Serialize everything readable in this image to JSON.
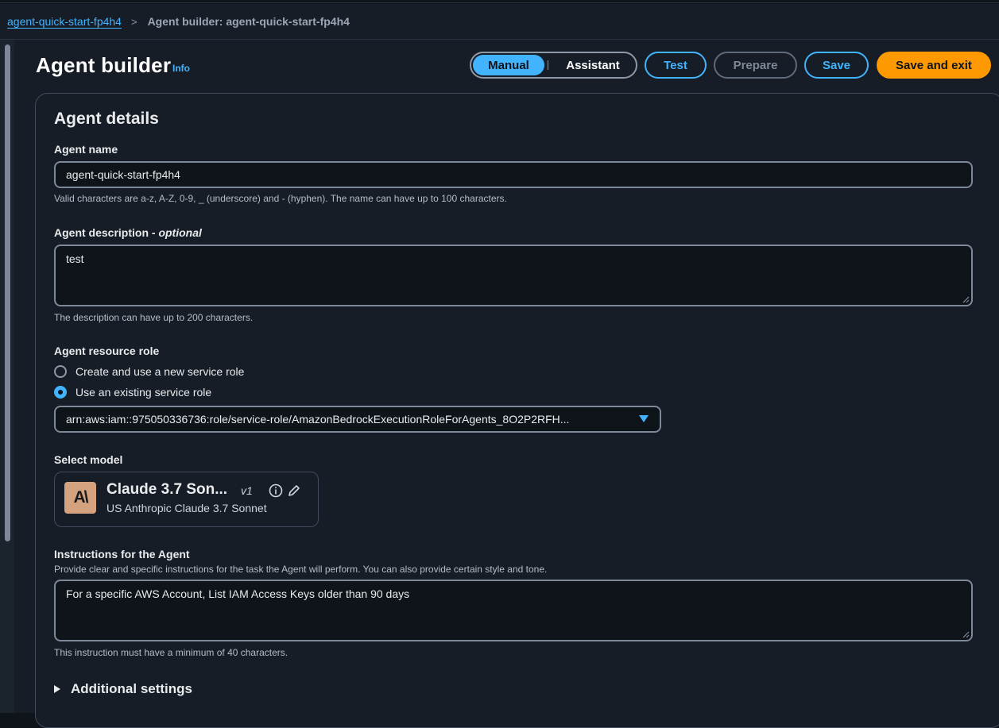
{
  "breadcrumb": {
    "parent": "agent-quick-start-fp4h4",
    "separator": ">",
    "current": "Agent builder: agent-quick-start-fp4h4"
  },
  "header": {
    "title": "Agent builder",
    "info": "Info",
    "mode_toggle": {
      "active": "Manual",
      "inactive": "Assistant"
    },
    "buttons": {
      "test": "Test",
      "prepare": "Prepare",
      "save": "Save",
      "save_exit": "Save and exit"
    }
  },
  "agent_details": {
    "heading": "Agent details",
    "name": {
      "label": "Agent name",
      "value": "agent-quick-start-fp4h4",
      "hint": "Valid characters are a-z, A-Z, 0-9, _ (underscore) and - (hyphen). The name can have up to 100 characters."
    },
    "description": {
      "label": "Agent description - ",
      "label_optional": "optional",
      "value": "test",
      "hint": "The description can have up to 200 characters."
    },
    "role": {
      "label": "Agent resource role",
      "option_new": "Create and use a new service role",
      "option_existing": "Use an existing service role",
      "selected_option": "Use an existing service role",
      "selected_role": "arn:aws:iam::975050336736:role/service-role/AmazonBedrockExecutionRoleForAgents_8O2P2RFH..."
    },
    "model": {
      "label": "Select model",
      "logo_text": "A\\",
      "name": "Claude 3.7 Son...",
      "version": "v1",
      "subtitle": "US Anthropic Claude 3.7 Sonnet"
    },
    "instructions": {
      "label": "Instructions for the Agent",
      "description": "Provide clear and specific instructions for the task the Agent will perform. You can also provide certain style and tone.",
      "value": "For a specific AWS Account, List IAM Access Keys older than 90 days",
      "hint": "This instruction must have a minimum of 40 characters."
    },
    "additional_settings": "Additional settings"
  },
  "colors": {
    "accent": "#42b4ff",
    "primary_button": "#ff9900",
    "background": "#161d26"
  }
}
